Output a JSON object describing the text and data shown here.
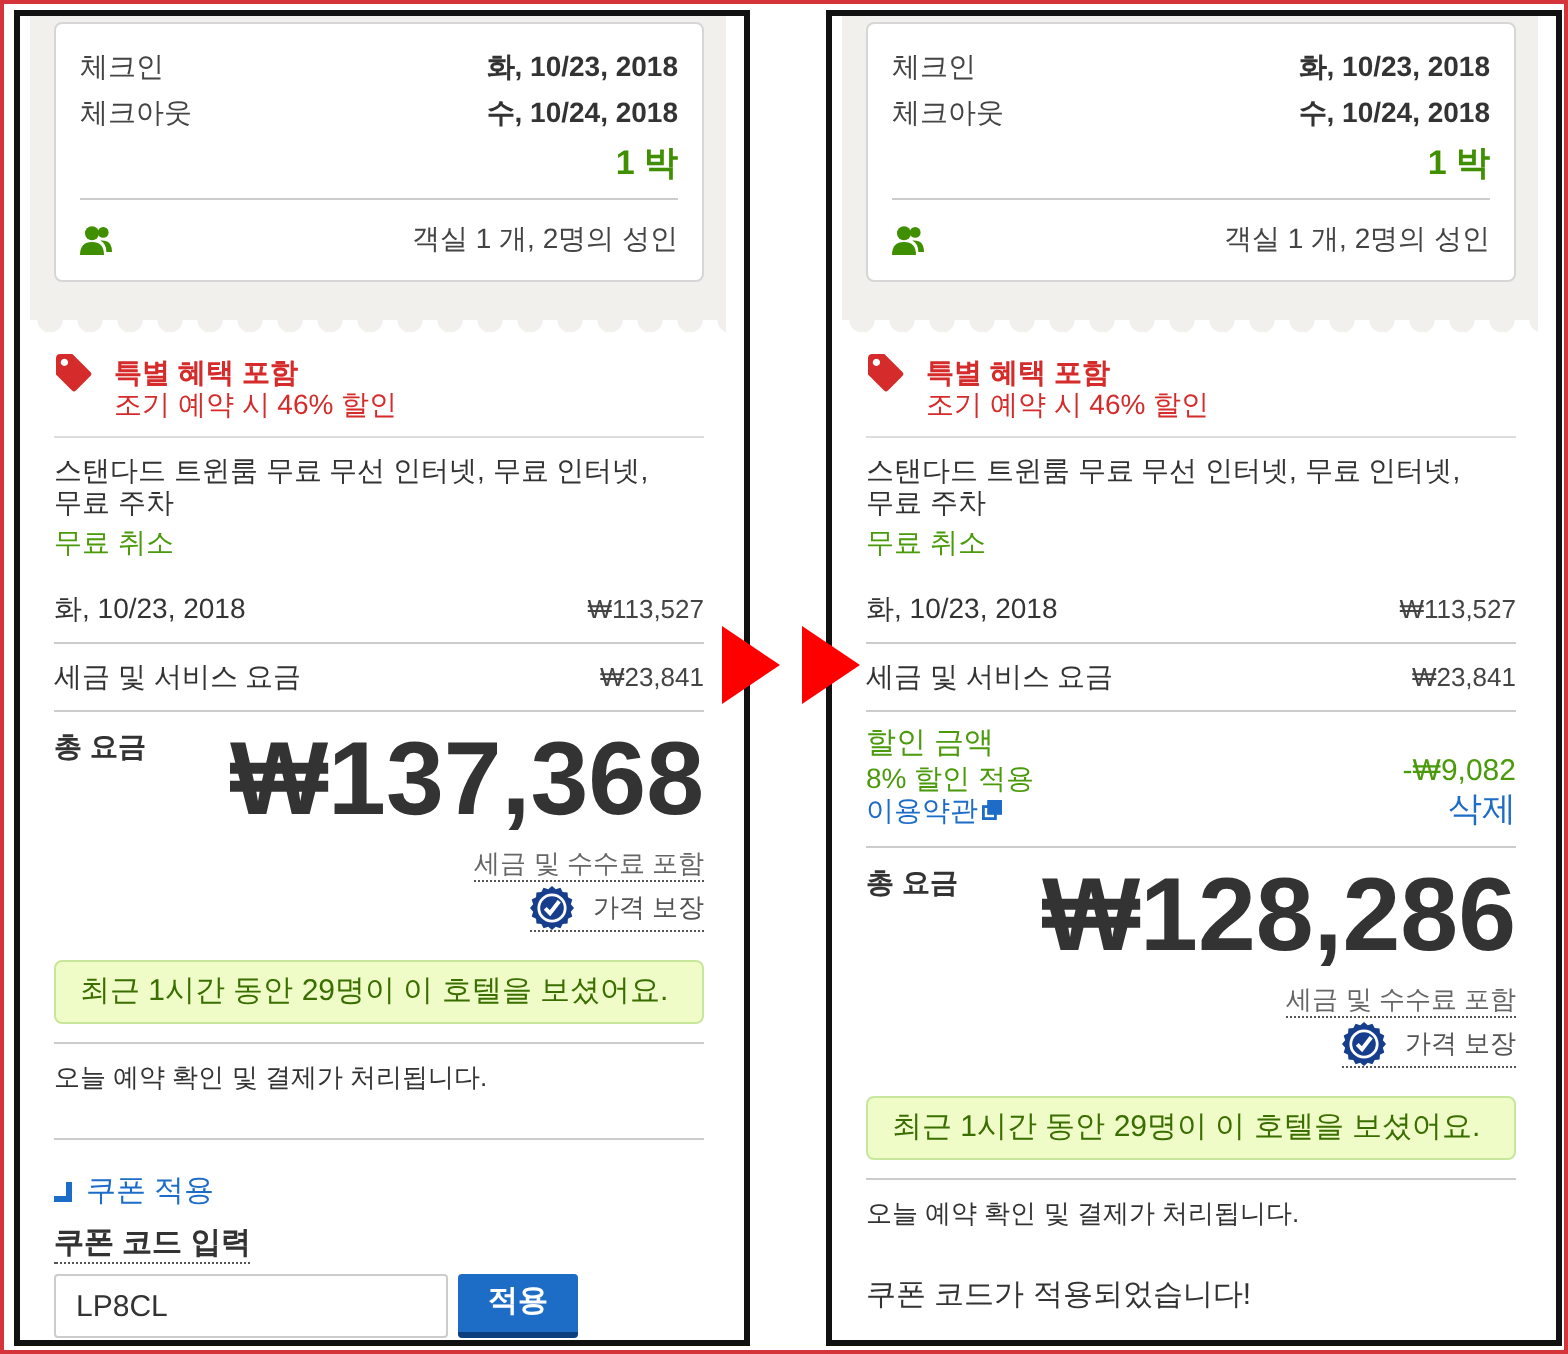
{
  "panels": [
    {
      "stay": {
        "dates": [
          {
            "label": "체크인",
            "value": "화, 10/23, 2018"
          },
          {
            "label": "체크아웃",
            "value": "수, 10/24, 2018"
          }
        ],
        "nights": "1 박",
        "guests": "객실 1 개, 2명의 성인"
      },
      "offer": {
        "title": "특별 혜택 포함",
        "detail": "조기 예약 시 46% 할인"
      },
      "room": {
        "description": "스탠다드 트윈룸 무료 무선 인터넷, 무료 인터넷, 무료 주차",
        "cancellation": "무료 취소"
      },
      "charges": [
        {
          "label": "화, 10/23, 2018",
          "amount": "₩113,527"
        },
        {
          "label": "세금 및 서비스 요금",
          "amount": "₩23,841"
        }
      ],
      "total": {
        "label": "총 요금",
        "amount": "₩137,368",
        "note": "세금 및 수수료 포함",
        "guarantee": "가격 보장"
      },
      "alert": "최근 1시간 동안 29명이 이 호텔을 보셨어요.",
      "payment_note": "오늘 예약 확인 및 결제가 처리됩니다.",
      "coupon": {
        "kind": "form",
        "toggle": "쿠폰 적용",
        "label": "쿠폰 코드 입력",
        "value": "LP8CL",
        "button": "적용"
      }
    },
    {
      "stay": {
        "dates": [
          {
            "label": "체크인",
            "value": "화, 10/23, 2018"
          },
          {
            "label": "체크아웃",
            "value": "수, 10/24, 2018"
          }
        ],
        "nights": "1 박",
        "guests": "객실 1 개, 2명의 성인"
      },
      "offer": {
        "title": "특별 혜택 포함",
        "detail": "조기 예약 시 46% 할인"
      },
      "room": {
        "description": "스탠다드 트윈룸 무료 무선 인터넷, 무료 인터넷, 무료 주차",
        "cancellation": "무료 취소"
      },
      "charges": [
        {
          "label": "화, 10/23, 2018",
          "amount": "₩113,527"
        },
        {
          "label": "세금 및 서비스 요금",
          "amount": "₩23,841"
        }
      ],
      "discount": {
        "title": "할인 금액",
        "detail": "8% 할인 적용",
        "terms": "이용약관",
        "amount": "-₩9,082",
        "remove": "삭제"
      },
      "total": {
        "label": "총 요금",
        "amount": "₩128,286",
        "note": "세금 및 수수료 포함",
        "guarantee": "가격 보장"
      },
      "alert": "최근 1시간 동안 29명이 이 호텔을 보셨어요.",
      "payment_note": "오늘 예약 확인 및 결제가 처리됩니다.",
      "coupon": {
        "kind": "message",
        "message": "쿠폰 코드가 적용되었습니다!"
      }
    }
  ]
}
